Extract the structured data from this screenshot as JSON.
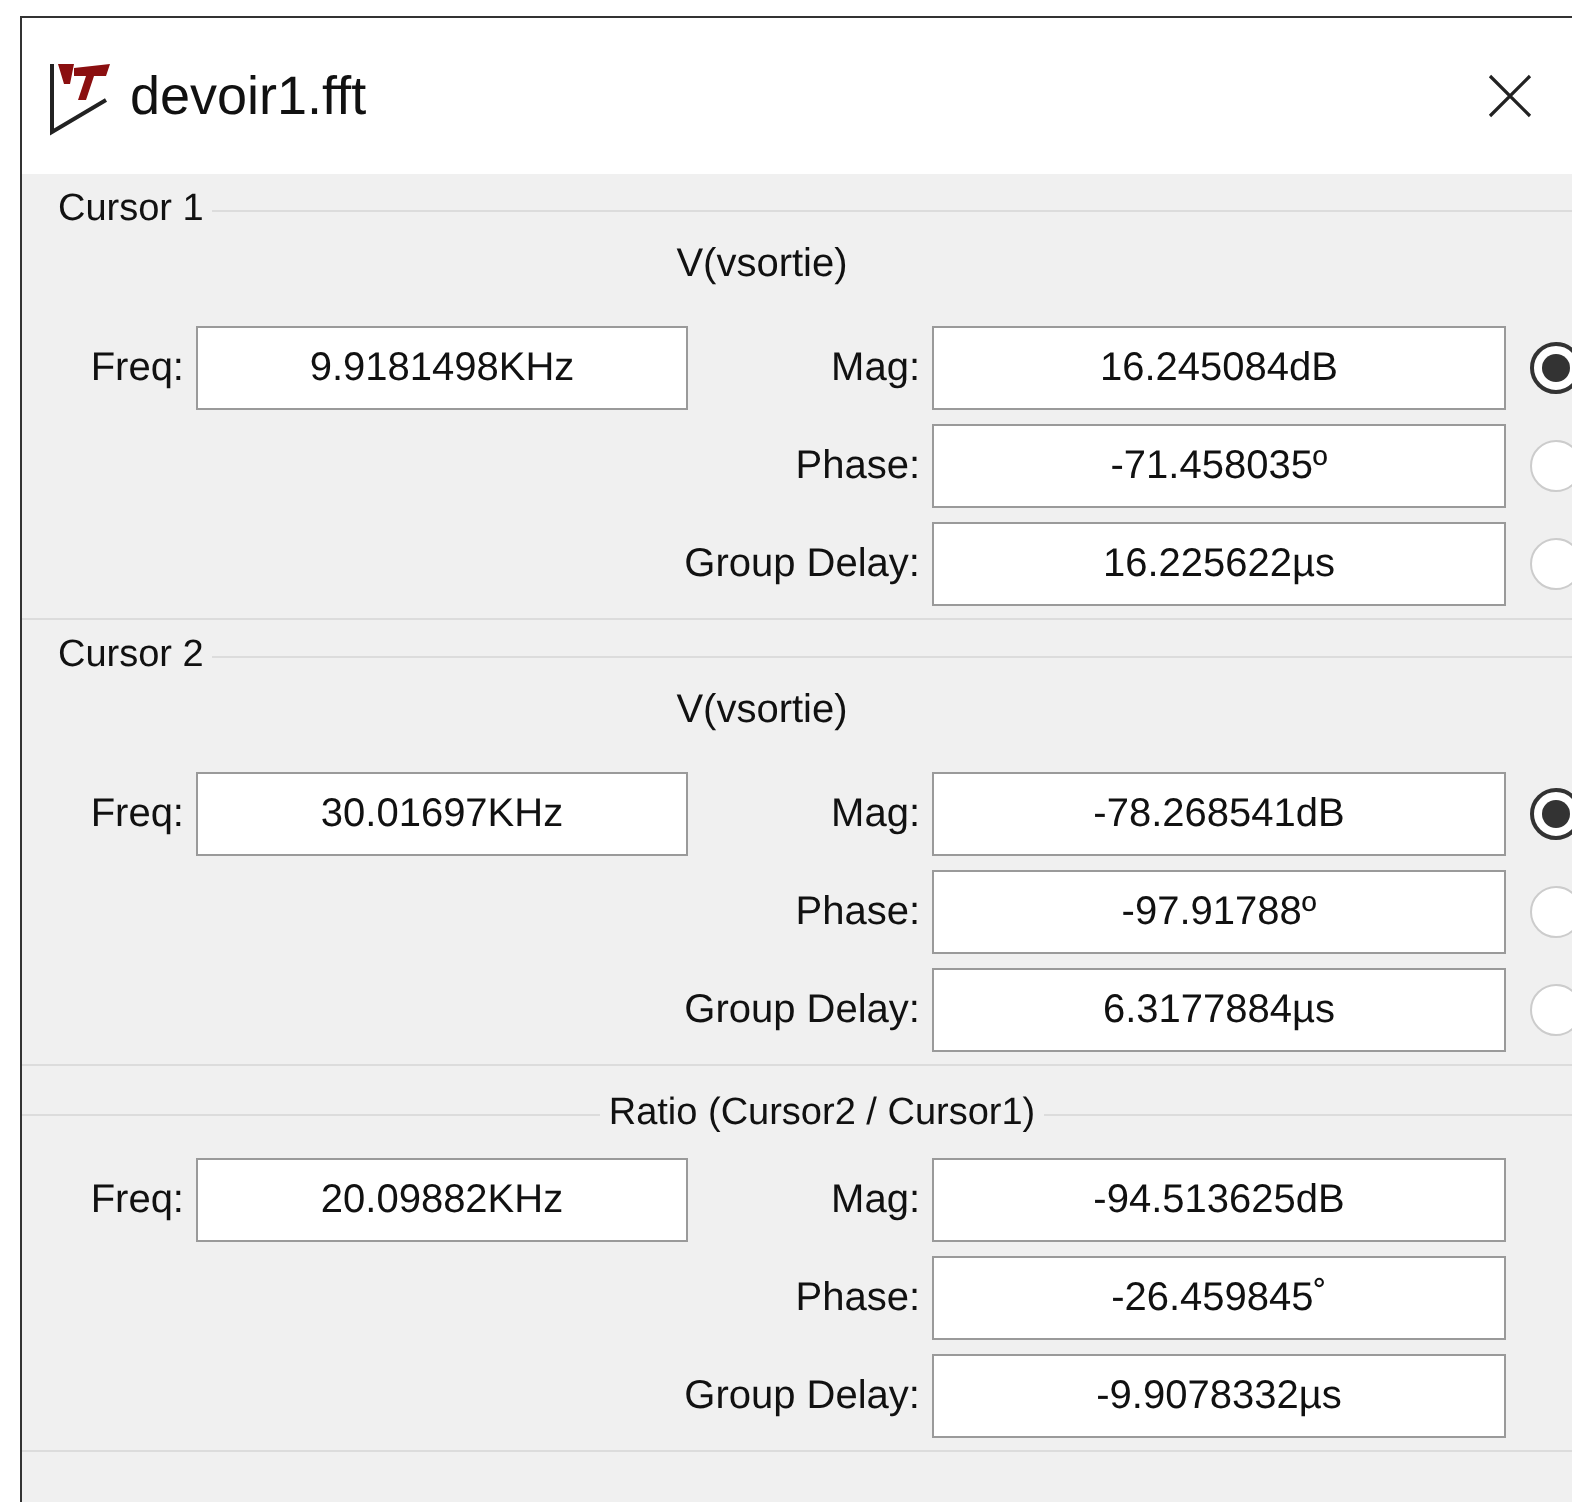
{
  "window": {
    "title": "devoir1.fft"
  },
  "sections": [
    {
      "kind": "cursor",
      "title": "Cursor 1",
      "signal": "V(vsortie)",
      "freq_label": "Freq:",
      "freq": "9.9181498KHz",
      "rows": [
        {
          "label": "Mag:",
          "value": "16.245084dB",
          "selected": true
        },
        {
          "label": "Phase:",
          "value": "-71.458035º",
          "selected": false
        },
        {
          "label": "Group Delay:",
          "value": "16.225622µs",
          "selected": false
        }
      ]
    },
    {
      "kind": "cursor",
      "title": "Cursor 2",
      "signal": "V(vsortie)",
      "freq_label": "Freq:",
      "freq": "30.01697KHz",
      "rows": [
        {
          "label": "Mag:",
          "value": "-78.268541dB",
          "selected": true
        },
        {
          "label": "Phase:",
          "value": "-97.91788º",
          "selected": false
        },
        {
          "label": "Group Delay:",
          "value": "6.3177884µs",
          "selected": false
        }
      ]
    },
    {
      "kind": "ratio",
      "title": "Ratio (Cursor2 / Cursor1)",
      "freq_label": "Freq:",
      "freq": "20.09882KHz",
      "rows": [
        {
          "label": "Mag:",
          "value": "-94.513625dB"
        },
        {
          "label": "Phase:",
          "value": "-26.459845˚"
        },
        {
          "label": "Group Delay:",
          "value": "-9.9078332µs"
        }
      ]
    }
  ]
}
